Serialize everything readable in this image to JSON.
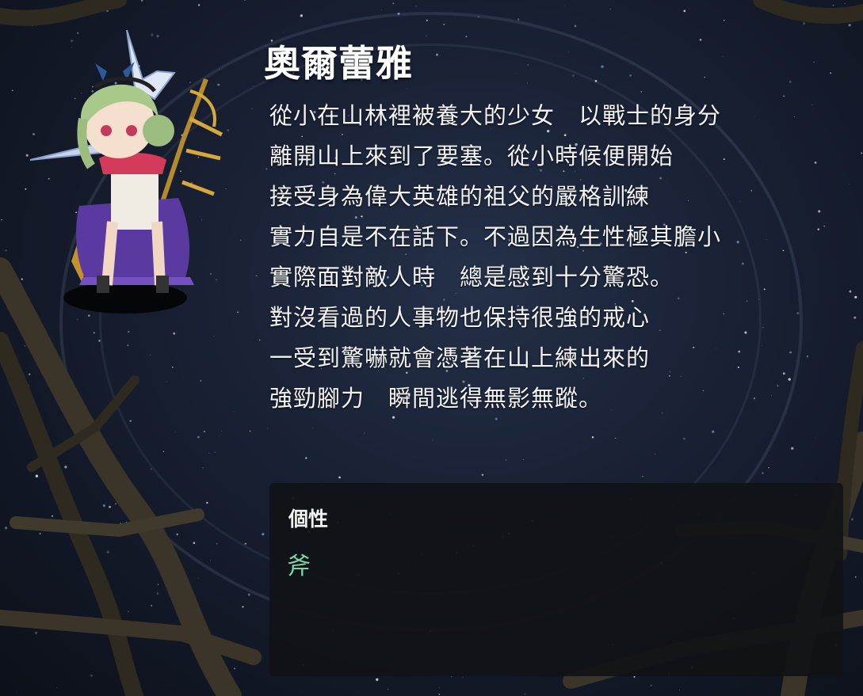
{
  "character": {
    "name": "奧爾蕾雅",
    "description_lines": [
      "從小在山林裡被養大的少女　以戰士的身分",
      "離開山上來到了要塞。從小時候便開始",
      "接受身為偉大英雄的祖父的嚴格訓練",
      "實力自是不在話下。不過因為生性極其膽小",
      "實際面對敵人時　總是感到十分驚恐。",
      "對沒看過的人事物也保持很強的戒心",
      "一受到驚嚇就會憑著在山上練出來的",
      "強勁腳力　瞬間逃得無影無蹤。"
    ]
  },
  "trait": {
    "label": "個性",
    "value": "斧"
  },
  "colors": {
    "trait_value": "#7fd4a8",
    "background": "#1a2236"
  }
}
